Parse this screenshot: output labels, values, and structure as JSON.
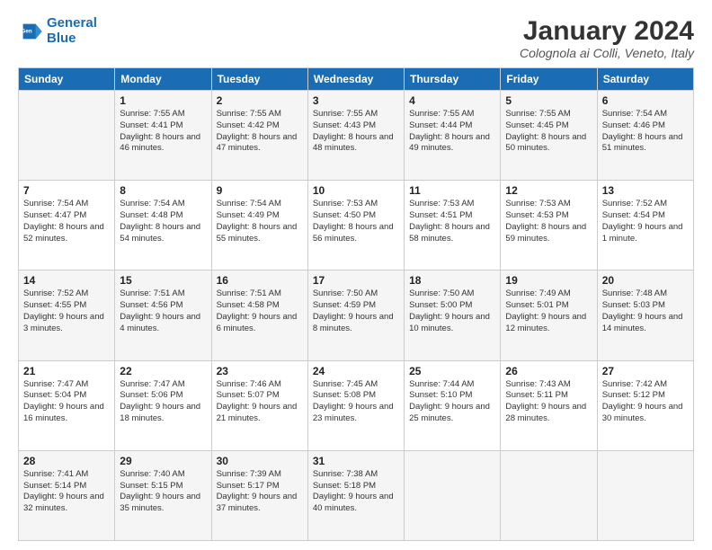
{
  "header": {
    "logo_line1": "General",
    "logo_line2": "Blue",
    "month_title": "January 2024",
    "location": "Colognola ai Colli, Veneto, Italy"
  },
  "weekdays": [
    "Sunday",
    "Monday",
    "Tuesday",
    "Wednesday",
    "Thursday",
    "Friday",
    "Saturday"
  ],
  "weeks": [
    [
      {
        "day": "",
        "info": ""
      },
      {
        "day": "1",
        "info": "Sunrise: 7:55 AM\nSunset: 4:41 PM\nDaylight: 8 hours\nand 46 minutes."
      },
      {
        "day": "2",
        "info": "Sunrise: 7:55 AM\nSunset: 4:42 PM\nDaylight: 8 hours\nand 47 minutes."
      },
      {
        "day": "3",
        "info": "Sunrise: 7:55 AM\nSunset: 4:43 PM\nDaylight: 8 hours\nand 48 minutes."
      },
      {
        "day": "4",
        "info": "Sunrise: 7:55 AM\nSunset: 4:44 PM\nDaylight: 8 hours\nand 49 minutes."
      },
      {
        "day": "5",
        "info": "Sunrise: 7:55 AM\nSunset: 4:45 PM\nDaylight: 8 hours\nand 50 minutes."
      },
      {
        "day": "6",
        "info": "Sunrise: 7:54 AM\nSunset: 4:46 PM\nDaylight: 8 hours\nand 51 minutes."
      }
    ],
    [
      {
        "day": "7",
        "info": "Sunrise: 7:54 AM\nSunset: 4:47 PM\nDaylight: 8 hours\nand 52 minutes."
      },
      {
        "day": "8",
        "info": "Sunrise: 7:54 AM\nSunset: 4:48 PM\nDaylight: 8 hours\nand 54 minutes."
      },
      {
        "day": "9",
        "info": "Sunrise: 7:54 AM\nSunset: 4:49 PM\nDaylight: 8 hours\nand 55 minutes."
      },
      {
        "day": "10",
        "info": "Sunrise: 7:53 AM\nSunset: 4:50 PM\nDaylight: 8 hours\nand 56 minutes."
      },
      {
        "day": "11",
        "info": "Sunrise: 7:53 AM\nSunset: 4:51 PM\nDaylight: 8 hours\nand 58 minutes."
      },
      {
        "day": "12",
        "info": "Sunrise: 7:53 AM\nSunset: 4:53 PM\nDaylight: 8 hours\nand 59 minutes."
      },
      {
        "day": "13",
        "info": "Sunrise: 7:52 AM\nSunset: 4:54 PM\nDaylight: 9 hours\nand 1 minute."
      }
    ],
    [
      {
        "day": "14",
        "info": "Sunrise: 7:52 AM\nSunset: 4:55 PM\nDaylight: 9 hours\nand 3 minutes."
      },
      {
        "day": "15",
        "info": "Sunrise: 7:51 AM\nSunset: 4:56 PM\nDaylight: 9 hours\nand 4 minutes."
      },
      {
        "day": "16",
        "info": "Sunrise: 7:51 AM\nSunset: 4:58 PM\nDaylight: 9 hours\nand 6 minutes."
      },
      {
        "day": "17",
        "info": "Sunrise: 7:50 AM\nSunset: 4:59 PM\nDaylight: 9 hours\nand 8 minutes."
      },
      {
        "day": "18",
        "info": "Sunrise: 7:50 AM\nSunset: 5:00 PM\nDaylight: 9 hours\nand 10 minutes."
      },
      {
        "day": "19",
        "info": "Sunrise: 7:49 AM\nSunset: 5:01 PM\nDaylight: 9 hours\nand 12 minutes."
      },
      {
        "day": "20",
        "info": "Sunrise: 7:48 AM\nSunset: 5:03 PM\nDaylight: 9 hours\nand 14 minutes."
      }
    ],
    [
      {
        "day": "21",
        "info": "Sunrise: 7:47 AM\nSunset: 5:04 PM\nDaylight: 9 hours\nand 16 minutes."
      },
      {
        "day": "22",
        "info": "Sunrise: 7:47 AM\nSunset: 5:06 PM\nDaylight: 9 hours\nand 18 minutes."
      },
      {
        "day": "23",
        "info": "Sunrise: 7:46 AM\nSunset: 5:07 PM\nDaylight: 9 hours\nand 21 minutes."
      },
      {
        "day": "24",
        "info": "Sunrise: 7:45 AM\nSunset: 5:08 PM\nDaylight: 9 hours\nand 23 minutes."
      },
      {
        "day": "25",
        "info": "Sunrise: 7:44 AM\nSunset: 5:10 PM\nDaylight: 9 hours\nand 25 minutes."
      },
      {
        "day": "26",
        "info": "Sunrise: 7:43 AM\nSunset: 5:11 PM\nDaylight: 9 hours\nand 28 minutes."
      },
      {
        "day": "27",
        "info": "Sunrise: 7:42 AM\nSunset: 5:12 PM\nDaylight: 9 hours\nand 30 minutes."
      }
    ],
    [
      {
        "day": "28",
        "info": "Sunrise: 7:41 AM\nSunset: 5:14 PM\nDaylight: 9 hours\nand 32 minutes."
      },
      {
        "day": "29",
        "info": "Sunrise: 7:40 AM\nSunset: 5:15 PM\nDaylight: 9 hours\nand 35 minutes."
      },
      {
        "day": "30",
        "info": "Sunrise: 7:39 AM\nSunset: 5:17 PM\nDaylight: 9 hours\nand 37 minutes."
      },
      {
        "day": "31",
        "info": "Sunrise: 7:38 AM\nSunset: 5:18 PM\nDaylight: 9 hours\nand 40 minutes."
      },
      {
        "day": "",
        "info": ""
      },
      {
        "day": "",
        "info": ""
      },
      {
        "day": "",
        "info": ""
      }
    ]
  ]
}
